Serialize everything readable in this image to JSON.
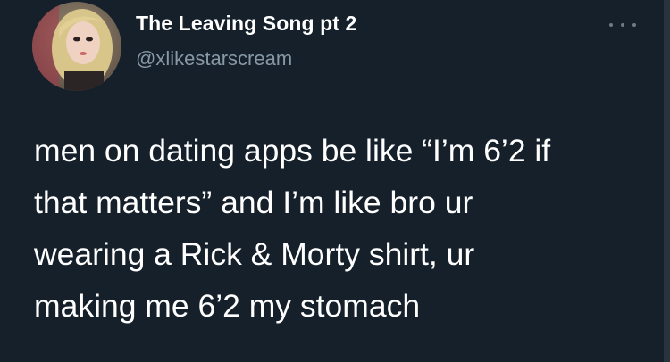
{
  "tweet": {
    "author": {
      "display_name": "The Leaving Song pt 2",
      "handle": "@xlikestarscream",
      "avatar_icon": "profile-photo"
    },
    "more_icon": "more-options-icon",
    "text_lines": [
      "men on dating apps be like “I’m 6’2 if",
      "that matters” and I’m like bro ur",
      "wearing a Rick & Morty shirt, ur",
      "making me 6’2 my stomach"
    ]
  },
  "theme": {
    "background": "#15202b",
    "text": "#ffffff",
    "secondary_text": "#8899a6"
  }
}
